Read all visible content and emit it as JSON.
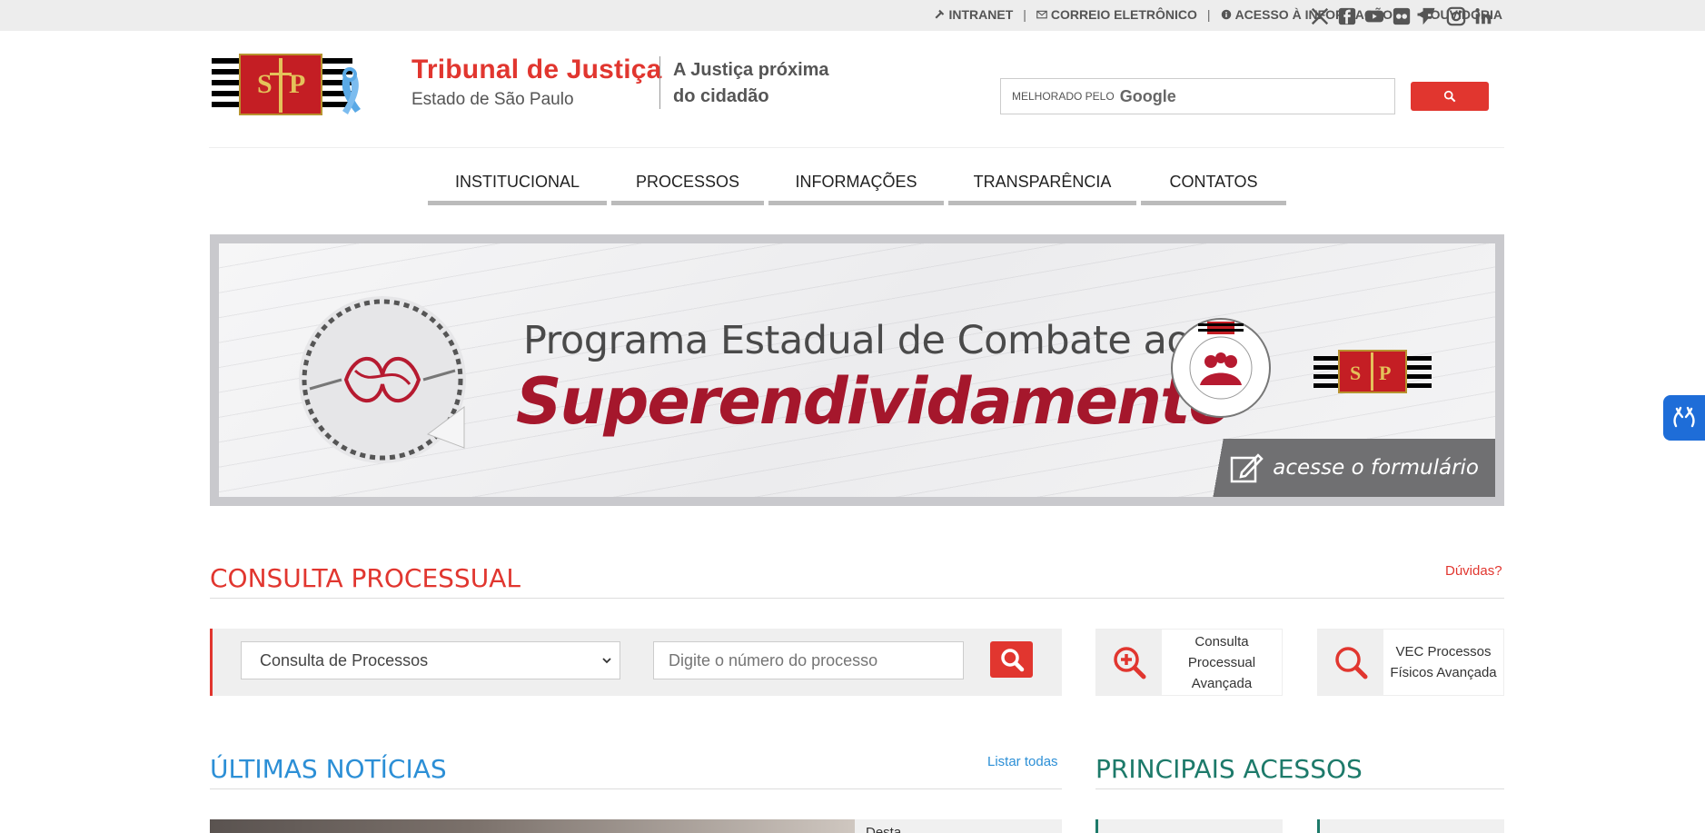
{
  "topbar": {
    "links": [
      {
        "label": "INTRANET",
        "icon": "gavel-icon"
      },
      {
        "label": "CORREIO ELETRÔNICO",
        "icon": "envelope-icon"
      },
      {
        "label": "ACESSO À INFORMAÇÃO",
        "icon": "info-icon"
      },
      {
        "label": "OUVIDORIA",
        "icon": "megaphone-icon"
      }
    ],
    "separator": "|",
    "social": [
      "x-icon",
      "facebook-icon",
      "youtube-icon",
      "flickr-icon",
      "foursquare-icon",
      "instagram-icon",
      "linkedin-icon"
    ]
  },
  "header": {
    "title": "Tribunal de Justiça",
    "subtitle": "Estado de São Paulo",
    "tagline": "A Justiça próxima do cidadão",
    "search": {
      "prefix": "MELHORADO PELO",
      "brand": "Google"
    },
    "brand_color": "#e1362f"
  },
  "nav": {
    "items": [
      {
        "label": "INSTITUCIONAL"
      },
      {
        "label": "PROCESSOS"
      },
      {
        "label": "INFORMAÇÕES"
      },
      {
        "label": "TRANSPARÊNCIA"
      },
      {
        "label": "CONTATOS"
      }
    ]
  },
  "banner": {
    "line1": "Programa Estadual de Combate ao",
    "line2": "Superendividamento",
    "cta": "acesse o formulário"
  },
  "consulta": {
    "title": "CONSULTA PROCESSUAL",
    "help": "Dúvidas?",
    "select_value": "Consulta de Processos",
    "input_placeholder": "Digite o número do processo",
    "quick": [
      {
        "label": "Consulta Processual Avançada",
        "icon": "zoom-in-icon"
      },
      {
        "label": "VEC Processos Físicos Avançada",
        "icon": "search-icon"
      }
    ]
  },
  "noticias": {
    "title": "ÚLTIMAS NOTÍCIAS",
    "list_all": "Listar todas",
    "first_snippet": "Desta..."
  },
  "acessos": {
    "title": "PRINCIPAIS ACESSOS"
  },
  "colors": {
    "red": "#e1362f",
    "blue": "#2c8fd6",
    "teal": "#1d7a6a",
    "banner_red": "#a5172c"
  }
}
